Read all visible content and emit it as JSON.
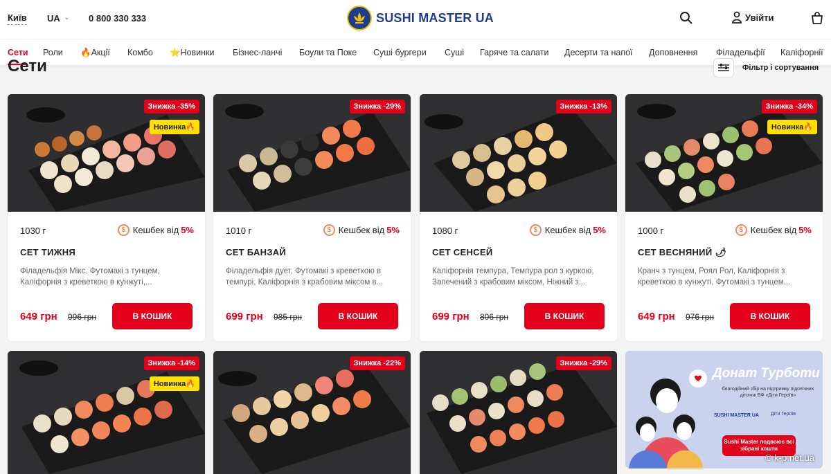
{
  "header": {
    "city": "Київ",
    "lang": "UA",
    "phone": "0 800 330 333",
    "brand": "SUSHI MASTER UA",
    "login_label": "Увійти"
  },
  "nav": {
    "items": [
      "Сети",
      "Роли",
      "🔥Акції",
      "Комбо",
      "⭐Новинки",
      "Бізнес-ланчі",
      "Боули та Поке",
      "Суші бургери",
      "Суші",
      "Гаряче та салати",
      "Десерти та напої",
      "Доповнення",
      "Філадельфії",
      "Каліфорнії"
    ],
    "active": "Сети"
  },
  "page": {
    "title": "Сети",
    "filter_label": "Фільтр і сортування"
  },
  "products": [
    {
      "weight": "1030 г",
      "cashback_label": "Кешбек від",
      "cashback_pct": "5%",
      "name": "СЕТ ТИЖНЯ",
      "desc": "Філадельфія Мікс, Футомакі з тунцем, Каліфорнія з креветкою в кунжуті,...",
      "price": "649 грн",
      "old_price": "996 грн",
      "discount": "Знижка -35%",
      "is_new": true,
      "new_label": "Новинка🔥",
      "buy_label": "В КОШИК"
    },
    {
      "weight": "1010 г",
      "cashback_label": "Кешбек від",
      "cashback_pct": "5%",
      "name": "СЕТ БАНЗАЙ",
      "desc": "Філадельфія дует, Футомакі з креветкою в темпурі, Каліфорнія з крабовим міксом в...",
      "price": "699 грн",
      "old_price": "985 грн",
      "discount": "Знижка -29%",
      "is_new": false,
      "new_label": "",
      "buy_label": "В КОШИК"
    },
    {
      "weight": "1080 г",
      "cashback_label": "Кешбек від",
      "cashback_pct": "5%",
      "name": "СЕТ СЕНСЕЙ",
      "desc": "Каліфорнія темпура, Темпура рол з куркою, Запечений з крабовим міксом, Ніжний з...",
      "price": "699 грн",
      "old_price": "806 грн",
      "discount": "Знижка -13%",
      "is_new": false,
      "new_label": "",
      "buy_label": "В КОШИК"
    },
    {
      "weight": "1000 г",
      "cashback_label": "Кешбек від",
      "cashback_pct": "5%",
      "name": "СЕТ ВЕСНЯНИЙ 🌶",
      "desc": "Кранч з тунцем, Роял Рол, Каліфорнія з креветкою в кунжуті, Футомакі з тунцем...",
      "price": "649 грн",
      "old_price": "976 грн",
      "discount": "Знижка -34%",
      "is_new": true,
      "new_label": "Новинка🔥",
      "buy_label": "В КОШИК"
    }
  ],
  "row2": [
    {
      "discount": "Знижка -14%",
      "new_label": "Новинка🔥"
    },
    {
      "discount": "Знижка -22%"
    },
    {
      "discount": "Знижка -29%"
    }
  ],
  "promo": {
    "title": "Донат Турботи",
    "subtitle": "благодійний збір на підтримку підопічних діточок БФ «Діти Героїв»",
    "logo1": "SUSHI MASTER UA",
    "logo2": "Діти Героїв",
    "button": "Sushi Master подвоює всі зібрані кошти"
  },
  "watermark": "© k-p.net.ua",
  "colors": {
    "accent": "#e3001b",
    "brand": "#1f3d8f",
    "new_badge": "#ffe000"
  }
}
